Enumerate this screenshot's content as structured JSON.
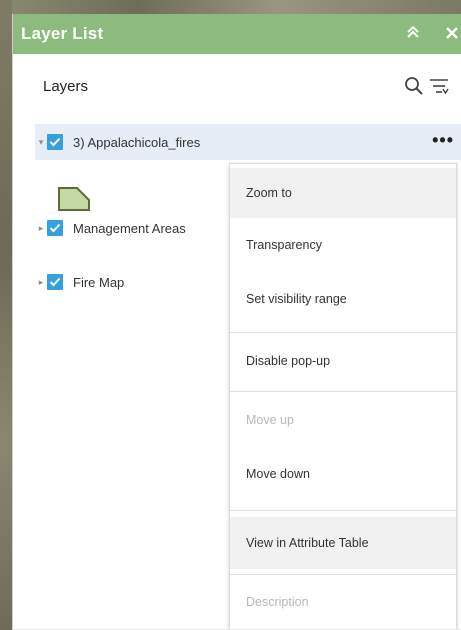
{
  "panel": {
    "title": "Layer List",
    "accent_color": "#8dbb7f",
    "collapse_icon": "double-chevron-up-icon",
    "close_icon": "close-icon"
  },
  "header": {
    "label": "Layers",
    "search_icon": "search-icon",
    "filter_icon": "filter-icon"
  },
  "layers": [
    {
      "name": "3) Appalachicola_fires",
      "checked": true,
      "expanded": true,
      "selected": true,
      "more_label": "•••"
    },
    {
      "name": "Management Areas",
      "checked": true,
      "expanded": false
    },
    {
      "name": "Fire Map",
      "checked": true,
      "expanded": false
    }
  ],
  "legend": {
    "swatch_fill": "#c5d9a6",
    "swatch_stroke": "#5d6a3a"
  },
  "context_menu": {
    "items": [
      {
        "label": "Zoom to",
        "highlighted": true,
        "disabled": false
      },
      {
        "label": "Transparency",
        "highlighted": false,
        "disabled": false
      },
      {
        "label": "Set visibility range",
        "highlighted": false,
        "disabled": false
      },
      {
        "label": "Disable pop-up",
        "highlighted": false,
        "disabled": false
      },
      {
        "label": "Move up",
        "highlighted": false,
        "disabled": true
      },
      {
        "label": "Move down",
        "highlighted": false,
        "disabled": false
      },
      {
        "label": "View in Attribute Table",
        "highlighted": true,
        "disabled": false
      },
      {
        "label": "Description",
        "highlighted": false,
        "disabled": true
      }
    ]
  },
  "colors": {
    "checkbox": "#34a0dd",
    "selected_row": "#e6edf6",
    "menu_highlight": "#f1f1f1"
  }
}
